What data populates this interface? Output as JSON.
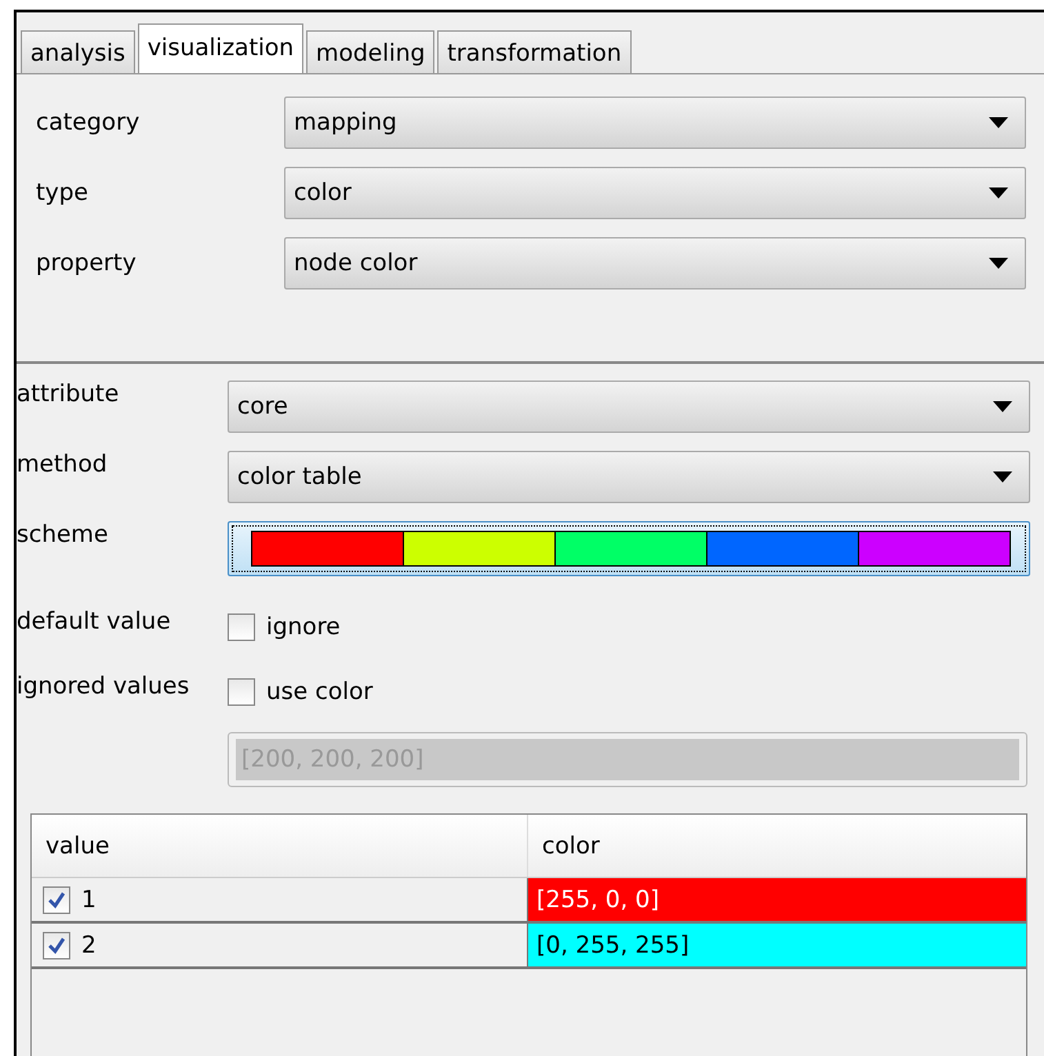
{
  "tabs": [
    {
      "label": "analysis",
      "selected": false
    },
    {
      "label": "visualization",
      "selected": true
    },
    {
      "label": "modeling",
      "selected": false
    },
    {
      "label": "transformation",
      "selected": false
    }
  ],
  "top_fields": [
    {
      "label": "category",
      "value": "mapping"
    },
    {
      "label": "type",
      "value": "color"
    },
    {
      "label": "property",
      "value": "node color"
    }
  ],
  "attribute": {
    "label": "attribute",
    "value": "core"
  },
  "method": {
    "label": "method",
    "value": "color table"
  },
  "scheme": {
    "label": "scheme",
    "swatches": [
      {
        "color": "#ff0000"
      },
      {
        "color": "#ccff00"
      },
      {
        "color": "#00ff66"
      },
      {
        "color": "#0066ff"
      },
      {
        "color": "#cc00ff"
      }
    ]
  },
  "default_value": {
    "label": "default value",
    "checkbox": "ignore",
    "checked": false
  },
  "ignored_values": {
    "label": "ignored values",
    "checkbox": "use color",
    "checked": false
  },
  "ignored_color": {
    "value": "[200, 200, 200]",
    "disabled": true
  },
  "table": {
    "columns": [
      "value",
      "color"
    ],
    "rows": [
      {
        "value": "1",
        "checked": true,
        "color_text": "[255, 0, 0]",
        "color": "#ff0000"
      },
      {
        "value": "2",
        "checked": true,
        "color_text": "[0, 255, 255]",
        "color": "#00ffff"
      }
    ]
  }
}
